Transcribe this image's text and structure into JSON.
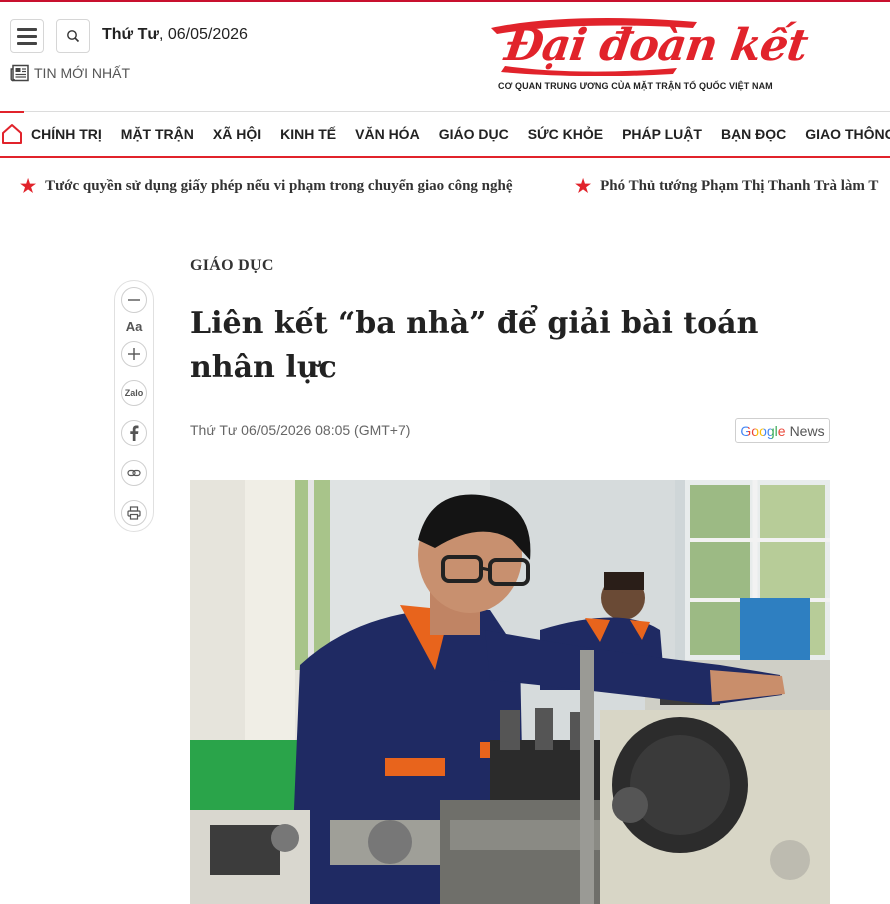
{
  "header": {
    "weekday": "Thứ Tư",
    "date": "06/05/2026",
    "latest_label": "TIN MỚI NHẤT",
    "logo_text": "Đại đoàn kết",
    "logo_tagline": "CƠ QUAN TRUNG ƯƠNG CỦA MẶT TRẬN TỔ QUỐC VIỆT NAM"
  },
  "nav": {
    "items": [
      "CHÍNH TRỊ",
      "MẶT TRẬN",
      "XÃ HỘI",
      "KINH TẾ",
      "VĂN HÓA",
      "GIÁO DỤC",
      "SỨC KHỎE",
      "PHÁP LUẬT",
      "BẠN ĐỌC",
      "GIAO THÔNG"
    ]
  },
  "ticker": {
    "items": [
      "Tước quyền sử dụng giấy phép nếu vi phạm trong chuyển giao công nghệ",
      "Phó Thủ tướng Phạm Thị Thanh Trà làm T"
    ]
  },
  "tools": {
    "font_label": "Aa",
    "zalo_label": "Zalo"
  },
  "article": {
    "category": "GIÁO DỤC",
    "title": "Liên kết “ba nhà” để giải bài toán nhân lực",
    "time": "Thứ Tư 06/05/2026 08:05 (GMT+7)",
    "google_label": "Google",
    "news_label": "News"
  },
  "colors": {
    "brand_red": "#e1232b",
    "uniform_navy": "#1f2a63",
    "uniform_orange": "#e8641c"
  }
}
